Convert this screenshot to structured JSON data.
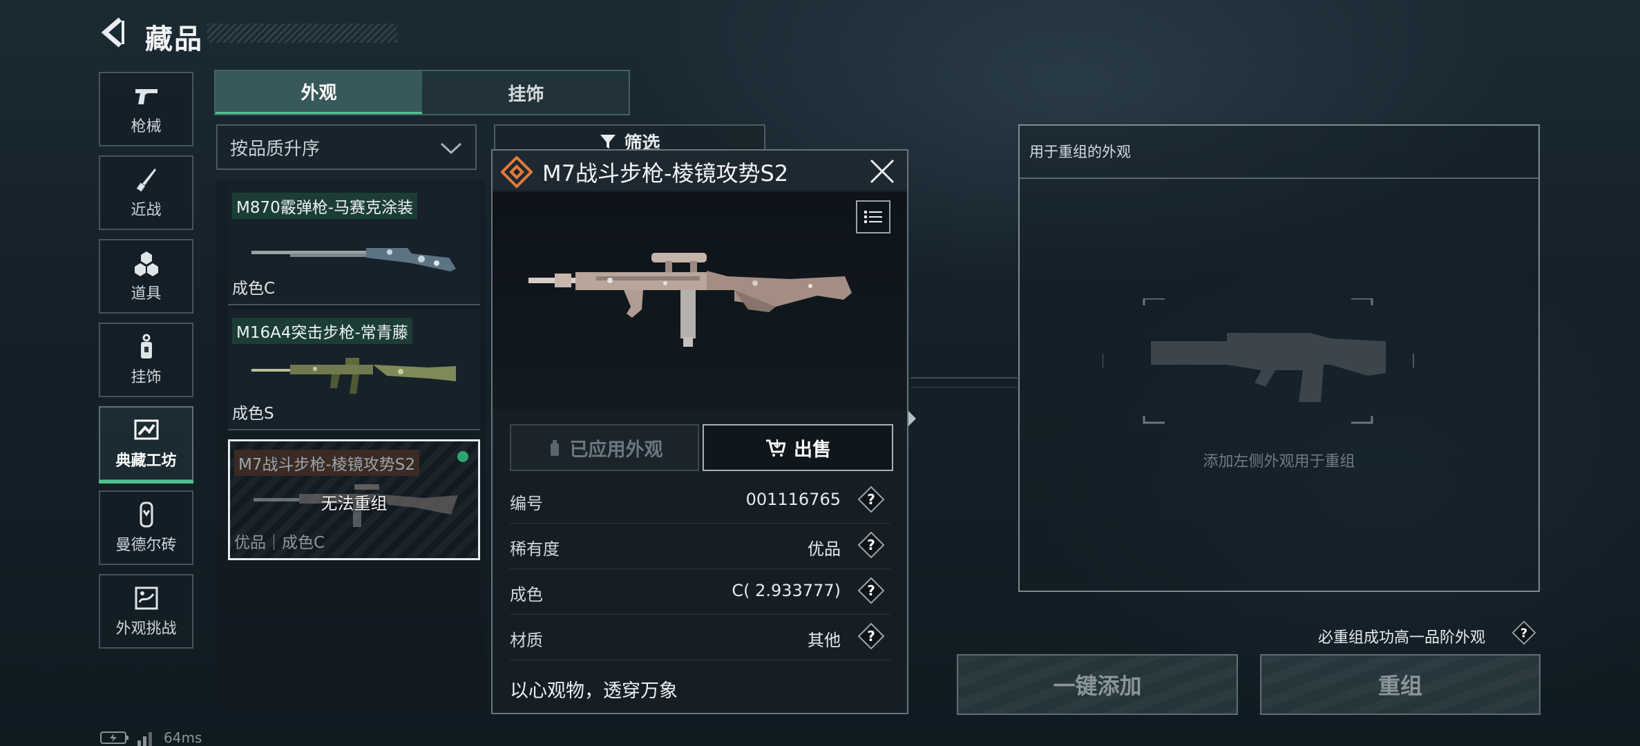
{
  "header": {
    "title": "藏品"
  },
  "sidebar": {
    "items": [
      {
        "label": "枪械",
        "icon": "pistol-icon"
      },
      {
        "label": "近战",
        "icon": "knife-icon"
      },
      {
        "label": "道具",
        "icon": "grenade-cluster-icon"
      },
      {
        "label": "挂饰",
        "icon": "keychain-charm-icon"
      },
      {
        "label": "典藏工坊",
        "icon": "workshop-icon",
        "active": true
      },
      {
        "label": "曼德尔砖",
        "icon": "mandel-brick-icon"
      },
      {
        "label": "外观挑战",
        "icon": "appearance-challenge-icon"
      }
    ]
  },
  "tabs": [
    {
      "label": "外观",
      "active": true
    },
    {
      "label": "挂饰",
      "active": false
    }
  ],
  "sort": {
    "value": "按品质升序"
  },
  "filter": {
    "label": "筛选"
  },
  "list": {
    "items": [
      {
        "name": "M870霰弹枪-马赛克涂装",
        "grade": "成色C"
      },
      {
        "name": "M16A4突击步枪-常青藤",
        "grade": "成色S"
      },
      {
        "name": "M7战斗步枪-棱镜攻势S2",
        "grade": "优品｜成色C",
        "overlay": "无法重组",
        "selected": true
      }
    ]
  },
  "popup": {
    "title": "M7战斗步枪-棱镜攻势S2",
    "applied_label": "已应用外观",
    "sell_label": "出售",
    "rows": [
      {
        "key": "编号",
        "value": "001116765"
      },
      {
        "key": "稀有度",
        "value": "优品"
      },
      {
        "key": "成色",
        "value": "C( 2.933777)"
      },
      {
        "key": "材质",
        "value": "其他"
      }
    ],
    "motto": "以心观物，透穿万象"
  },
  "recombine": {
    "panel_title": "用于重组的外观",
    "hint": "添加左侧外观用于重组",
    "must_text": "必重组成功高一品阶外观",
    "add_all_label": "一键添加",
    "recombine_label": "重组"
  },
  "status": {
    "ping": "64ms"
  },
  "colors": {
    "accent": "#4fc38f",
    "selected_dot": "#2fa36e",
    "diamond": "#e07a3a"
  }
}
